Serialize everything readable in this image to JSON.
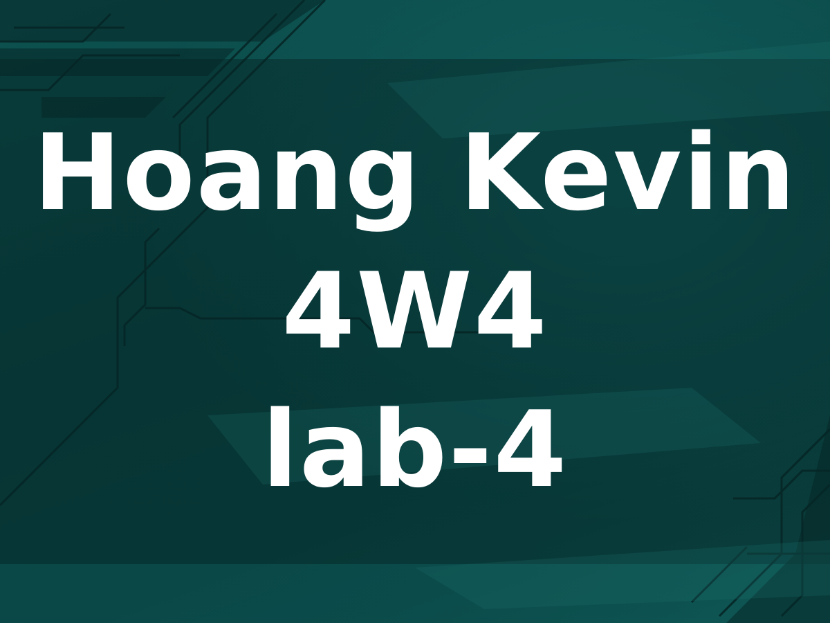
{
  "title_lines": {
    "name": "Hoang Kevin",
    "code": "4W4",
    "lab": "lab-4"
  },
  "colors": {
    "background": "#0c4a4a",
    "text": "#ffffff",
    "circuit_lines": "#062626"
  }
}
